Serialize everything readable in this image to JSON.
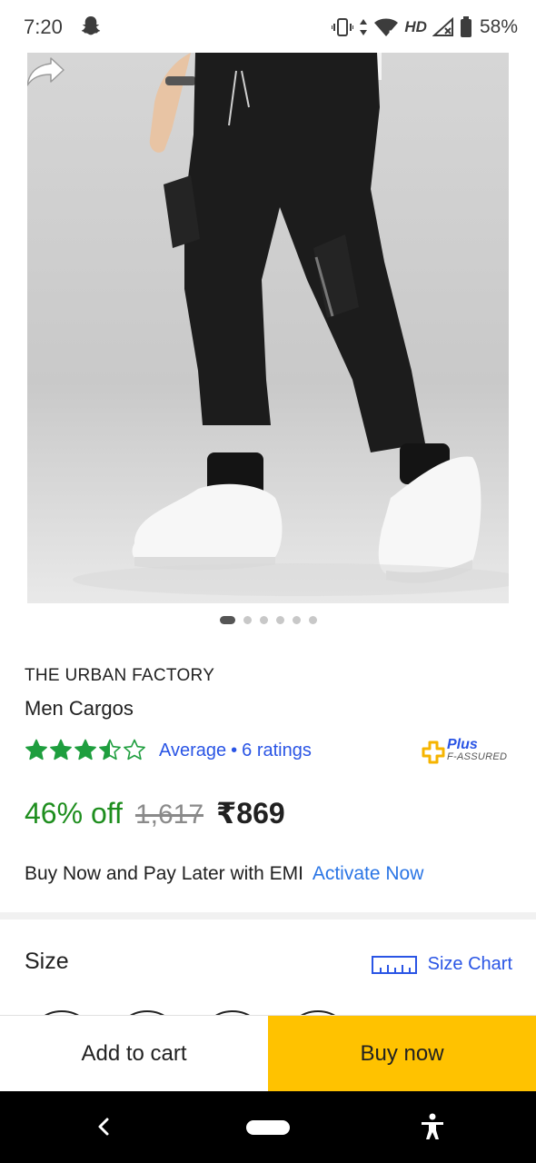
{
  "status_bar": {
    "time": "7:20",
    "network_label": "HD",
    "battery": "58%"
  },
  "gallery": {
    "image_count": 6,
    "active_index": 0
  },
  "product": {
    "brand": "THE URBAN FACTORY",
    "name": "Men Cargos",
    "rating_stars": 3.5,
    "rating_label": "Average",
    "rating_separator": "•",
    "rating_count": "6 ratings",
    "assured_plus": "Plus",
    "assured_text": "F-ASSURED",
    "discount": "46% off",
    "mrp": "1,617",
    "price": "₹869"
  },
  "emi": {
    "text": "Buy Now and Pay Later with EMI",
    "link": "Activate Now"
  },
  "size": {
    "title": "Size",
    "chart_label": "Size Chart"
  },
  "actions": {
    "add_to_cart": "Add to cart",
    "buy_now": "Buy now"
  },
  "colors": {
    "accent_blue": "#2a55e5",
    "discount_green": "#1e8e1e",
    "star_green": "#1e9e3e",
    "buy_yellow": "#ffc200"
  },
  "icons": [
    "snapchat-icon",
    "vibrate-icon",
    "wifi-icon",
    "signal-icon",
    "battery-icon",
    "share-icon",
    "assured-icon",
    "ruler-icon",
    "back-icon",
    "accessibility-icon"
  ]
}
